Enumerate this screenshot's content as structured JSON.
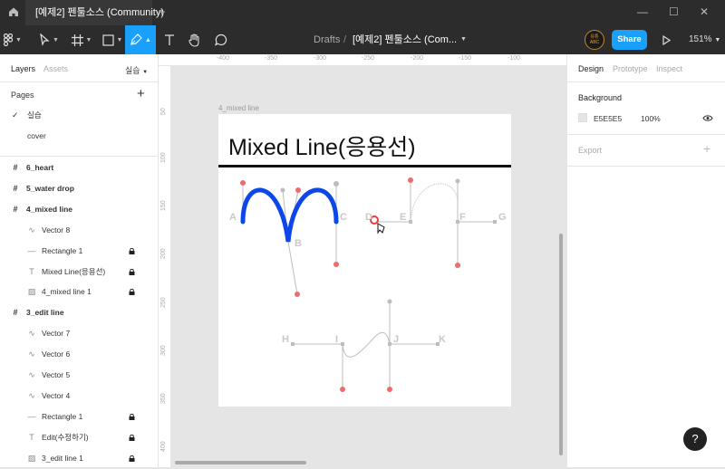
{
  "titlebar": {
    "tab_title": "[예제2] 펜툴소스 (Community)",
    "home_icon": "home-icon",
    "new_tab": "+",
    "minimize": "—",
    "maximize": "☐",
    "close": "✕"
  },
  "toolbar": {
    "breadcrumb_drafts": "Drafts",
    "separator": "/",
    "file_name": "[예제2] 펜툴소스 (Com...",
    "share_label": "Share",
    "zoom_label": "151%",
    "avatar_text": "유튜 ABC",
    "tools": [
      "menu-icon",
      "move-icon",
      "frame-icon",
      "rectangle-icon",
      "pen-icon",
      "text-icon",
      "hand-icon",
      "comment-icon",
      "present-icon"
    ]
  },
  "left_panel": {
    "tab_layers": "Layers",
    "tab_assets": "Assets",
    "page_selector": "실습",
    "pages_title": "Pages",
    "pages": [
      {
        "label": "실습",
        "active": true
      },
      {
        "label": "cover",
        "active": false
      }
    ],
    "layers": [
      {
        "label": "6_heart",
        "type": "frame",
        "indent": 0,
        "locked": false
      },
      {
        "label": "5_water drop",
        "type": "frame",
        "indent": 0,
        "locked": false
      },
      {
        "label": "4_mixed line",
        "type": "frame",
        "indent": 0,
        "locked": false
      },
      {
        "label": "Vector 8",
        "type": "vector",
        "indent": 1,
        "locked": false
      },
      {
        "label": "Rectangle 1",
        "type": "rect",
        "indent": 1,
        "locked": true
      },
      {
        "label": "Mixed Line(응용선)",
        "type": "text",
        "indent": 1,
        "locked": true
      },
      {
        "label": "4_mixed line 1",
        "type": "image",
        "indent": 1,
        "locked": true
      },
      {
        "label": "3_edit line",
        "type": "frame",
        "indent": 0,
        "locked": false
      },
      {
        "label": "Vector 7",
        "type": "vector",
        "indent": 1,
        "locked": false
      },
      {
        "label": "Vector 6",
        "type": "vector",
        "indent": 1,
        "locked": false
      },
      {
        "label": "Vector 5",
        "type": "vector",
        "indent": 1,
        "locked": false
      },
      {
        "label": "Vector 4",
        "type": "vector",
        "indent": 1,
        "locked": false
      },
      {
        "label": "Rectangle 1",
        "type": "rect",
        "indent": 1,
        "locked": true
      },
      {
        "label": "Edit(수정하기)",
        "type": "text",
        "indent": 1,
        "locked": true
      },
      {
        "label": "3_edit line 1",
        "type": "image",
        "indent": 1,
        "locked": true
      }
    ]
  },
  "right_panel": {
    "tab_design": "Design",
    "tab_prototype": "Prototype",
    "tab_inspect": "Inspect",
    "background_title": "Background",
    "background_hex": "E5E5E5",
    "background_opacity": "100%",
    "export_title": "Export",
    "export_add": "+"
  },
  "rulers": {
    "top": [
      "-400",
      "-350",
      "-300",
      "-250",
      "-200",
      "-150",
      "-100"
    ],
    "left": [
      "50",
      "100",
      "150",
      "200",
      "250",
      "300",
      "350",
      "400"
    ]
  },
  "canvas": {
    "frame_label": "4_mixed line",
    "frame_title": "Mixed Line(응용선)",
    "point_labels": [
      "A",
      "B",
      "C",
      "D",
      "E",
      "F",
      "G",
      "H",
      "I",
      "J",
      "K"
    ],
    "help": "?"
  },
  "colors": {
    "accent": "#18a0fb",
    "stroke_blue": "#0d47e8",
    "handle_red": "#ee6b6b",
    "guide_gray": "#bdbdbd",
    "dark_bar": "#2c2c2c"
  }
}
